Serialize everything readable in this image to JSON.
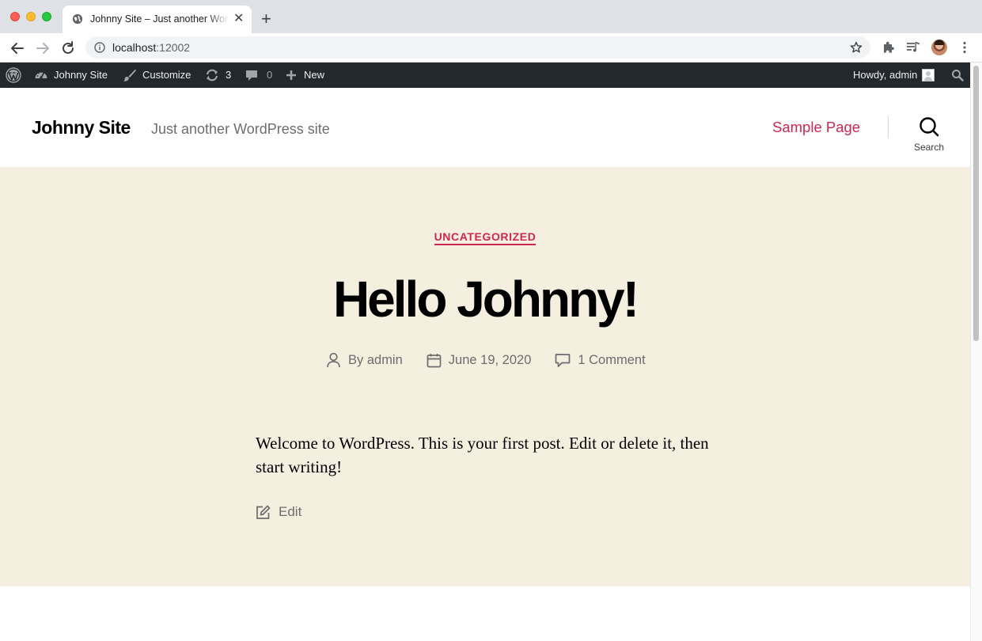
{
  "browser": {
    "tab": {
      "title": "Johnny Site – Just another WordPress site"
    },
    "url": {
      "host": "localhost",
      "port": ":12002"
    },
    "icons": [
      "back-arrow-icon",
      "forward-arrow-icon",
      "reload-icon",
      "info-icon",
      "star-icon",
      "extensions-icon",
      "media-queue-icon",
      "profile-avatar",
      "more-vertical-icon"
    ]
  },
  "admin_bar": {
    "site_name": "Johnny Site",
    "customize": "Customize",
    "updates_count": "3",
    "comments_count": "0",
    "new": "New",
    "howdy": "Howdy, admin"
  },
  "header": {
    "site_title": "Johnny Site",
    "site_description": "Just another WordPress site",
    "menu": [
      "Sample Page"
    ],
    "search_label": "Search"
  },
  "post": {
    "category": "UNCATEGORIZED",
    "title": "Hello Johnny!",
    "author": "By admin",
    "date": "June 19, 2020",
    "comments": "1 Comment",
    "content": "Welcome to WordPress. This is your first post. Edit or delete it, then start writing!",
    "edit": "Edit"
  },
  "colors": {
    "accent": "#cd2653",
    "entry_header_bg": "#f5efe0",
    "admin_bar_bg": "#23282d",
    "text_secondary": "#6d6d6d"
  }
}
